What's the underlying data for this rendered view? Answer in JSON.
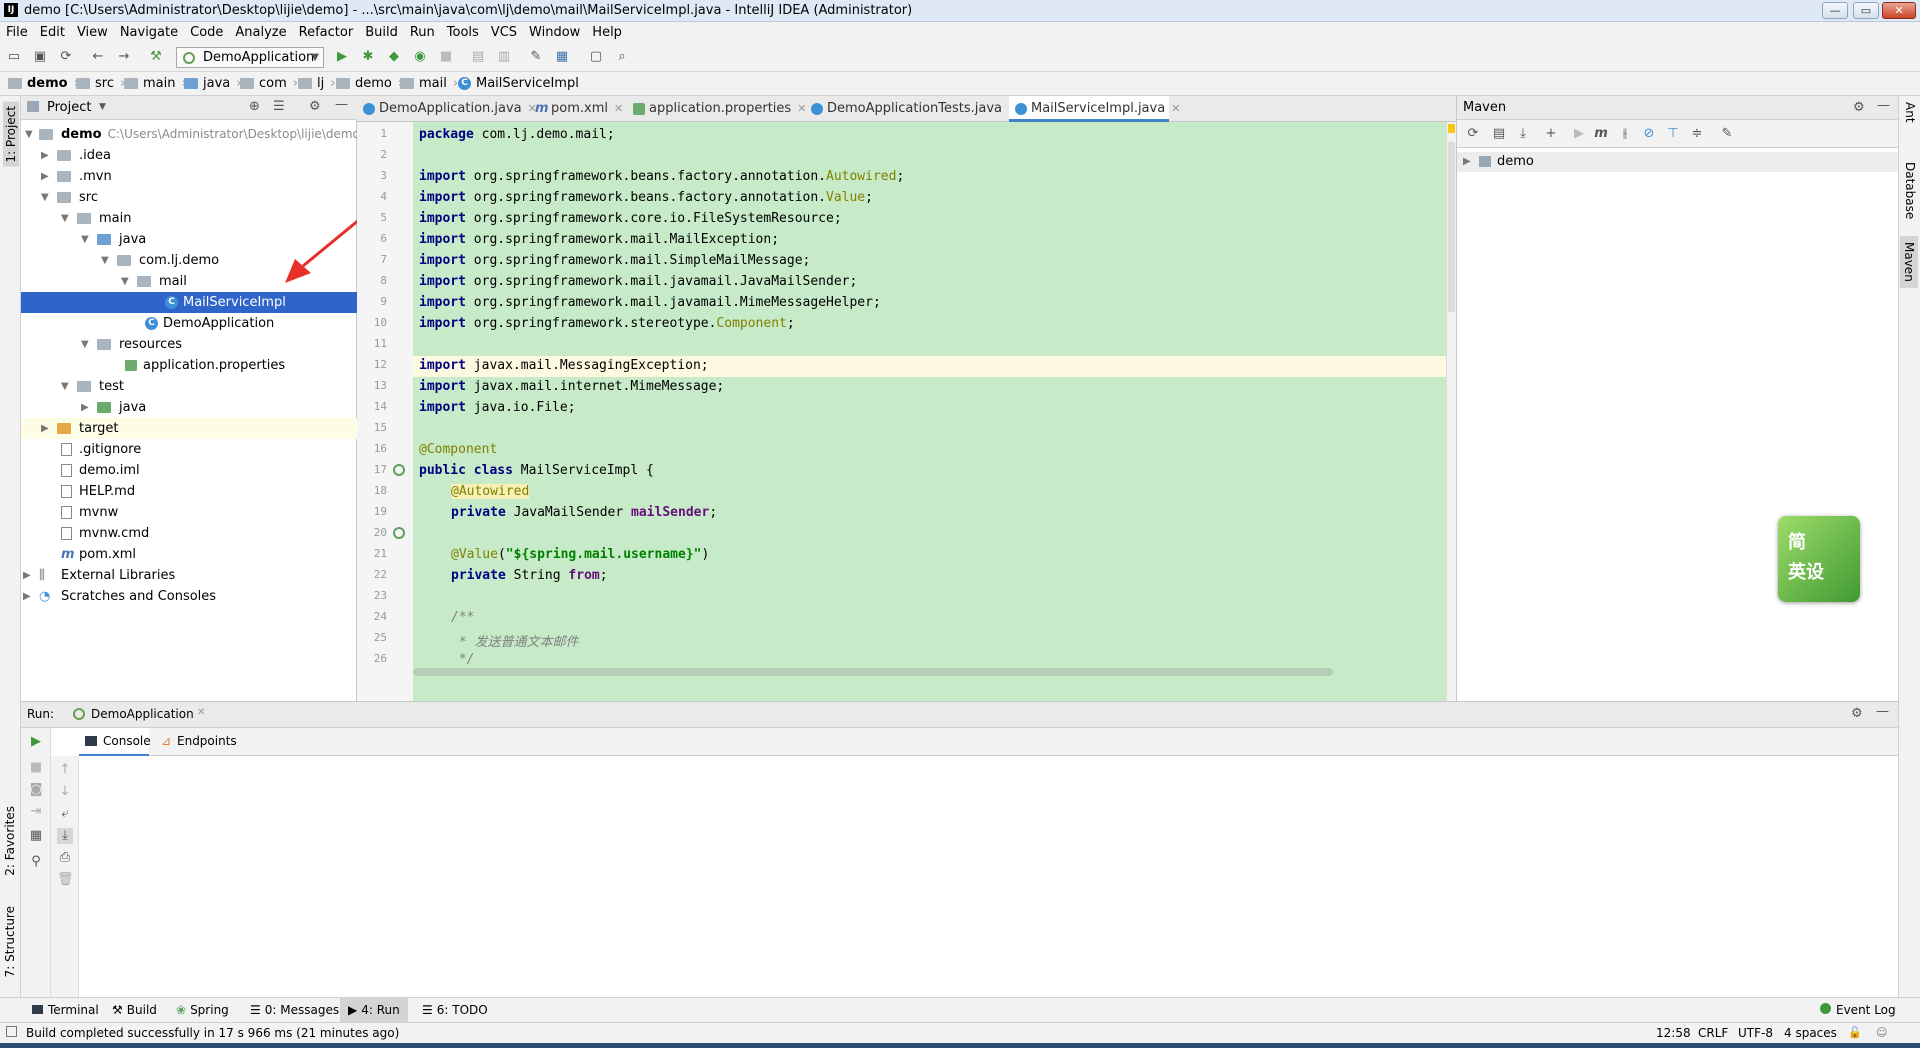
{
  "window": {
    "title": "demo [C:\\Users\\Administrator\\Desktop\\lijie\\demo] - ...\\src\\main\\java\\com\\lj\\demo\\mail\\MailServiceImpl.java - IntelliJ IDEA (Administrator)",
    "logo": "IJ",
    "minimize": "—",
    "maximize": "▭",
    "close": "✕"
  },
  "menu": [
    "File",
    "Edit",
    "View",
    "Navigate",
    "Code",
    "Analyze",
    "Refactor",
    "Build",
    "Run",
    "Tools",
    "VCS",
    "Window",
    "Help"
  ],
  "toolbar": {
    "run_config": "DemoApplication",
    "icons": [
      "folder-open-icon",
      "save-icon",
      "sync-icon",
      "back-icon",
      "forward-icon",
      "hammer-icon",
      "run-icon",
      "debug-icon",
      "coverage-icon",
      "profile-icon",
      "stop-icon",
      "vcs-update-icon",
      "vcs-commit-icon",
      "wrench-icon",
      "structure-icon",
      "frame-icon",
      "search-icon"
    ]
  },
  "breadcrumb": [
    "demo",
    "src",
    "main",
    "java",
    "com",
    "lj",
    "demo",
    "mail",
    "MailServiceImpl"
  ],
  "left_stripe": {
    "project": "1: Project",
    "favorites": "2: Favorites",
    "structure": "7: Structure"
  },
  "project_panel": {
    "title": "Project",
    "items": [
      {
        "label": "demo",
        "path": "C:\\Users\\Administrator\\Desktop\\lijie\\demo"
      },
      {
        "label": ".idea"
      },
      {
        "label": ".mvn"
      },
      {
        "label": "src"
      },
      {
        "label": "main"
      },
      {
        "label": "java"
      },
      {
        "label": "com.lj.demo"
      },
      {
        "label": "mail"
      },
      {
        "label": "MailServiceImpl"
      },
      {
        "label": "DemoApplication"
      },
      {
        "label": "resources"
      },
      {
        "label": "application.properties"
      },
      {
        "label": "test"
      },
      {
        "label": "java"
      },
      {
        "label": "target"
      },
      {
        "label": ".gitignore"
      },
      {
        "label": "demo.iml"
      },
      {
        "label": "HELP.md"
      },
      {
        "label": "mvnw"
      },
      {
        "label": "mvnw.cmd"
      },
      {
        "label": "pom.xml"
      },
      {
        "label": "External Libraries"
      },
      {
        "label": "Scratches and Consoles"
      }
    ]
  },
  "editor": {
    "tabs": [
      {
        "label": "DemoApplication.java"
      },
      {
        "label": "pom.xml"
      },
      {
        "label": "application.properties"
      },
      {
        "label": "DemoApplicationTests.java"
      },
      {
        "label": "MailServiceImpl.java"
      }
    ],
    "line_numbers": [
      "1",
      "2",
      "3",
      "4",
      "5",
      "6",
      "7",
      "8",
      "9",
      "10",
      "11",
      "12",
      "13",
      "14",
      "15",
      "16",
      "17",
      "18",
      "19",
      "20",
      "21",
      "22",
      "23",
      "24",
      "25",
      "26"
    ],
    "lines": {
      "l1": {
        "kw": "package",
        "rest": " com.lj.demo.mail;"
      },
      "l3": {
        "kw": "import",
        "rest": " org.springframework.beans.factory.annotation.",
        "an": "Autowired",
        "end": ";"
      },
      "l4": {
        "kw": "import",
        "rest": " org.springframework.beans.factory.annotation.",
        "an": "Value",
        "end": ";"
      },
      "l5": {
        "kw": "import",
        "rest": " org.springframework.core.io.FileSystemResource;"
      },
      "l6": {
        "kw": "import",
        "rest": " org.springframework.mail.MailException;"
      },
      "l7": {
        "kw": "import",
        "rest": " org.springframework.mail.SimpleMailMessage;"
      },
      "l8": {
        "kw": "import",
        "rest": " org.springframework.mail.javamail.JavaMailSender;"
      },
      "l9": {
        "kw": "import",
        "rest": " org.springframework.mail.javamail.MimeMessageHelper;"
      },
      "l10": {
        "kw": "import",
        "rest": " org.springframework.stereotype.",
        "an": "Component",
        "end": ";"
      },
      "l12": {
        "kw": "import",
        "rest": " javax.mail.MessagingException;"
      },
      "l13": {
        "kw": "import",
        "rest": " javax.mail.internet.MimeMessage;"
      },
      "l14": {
        "kw": "import",
        "rest": " java.io.File;"
      },
      "l16": {
        "an": "@Component"
      },
      "l17": {
        "kw": "public class",
        "rest": " MailServiceImpl {"
      },
      "l18": {
        "an": "@Autowired"
      },
      "l19": {
        "kw": "private",
        "rest": " JavaMailSender ",
        "fld": "mailSender",
        "end": ";"
      },
      "l21": {
        "an": "@Value",
        "open": "(",
        "str": "\"${spring.mail.username}\"",
        "end": ")"
      },
      "l22": {
        "kw": "private",
        "rest": " String ",
        "fld": "from",
        "end": ";"
      },
      "l24": {
        "cmt": "/**"
      },
      "l25": {
        "cmt": " * 发送普通文本邮件"
      },
      "l26": {
        "cmt": " */"
      }
    }
  },
  "maven_panel": {
    "title": "Maven",
    "root": "demo"
  },
  "right_stripe": {
    "ant": "Ant",
    "database": "Database",
    "maven": "Maven"
  },
  "run_panel": {
    "label": "Run:",
    "config": "DemoApplication",
    "tabs": [
      "Console",
      "Endpoints"
    ]
  },
  "tool_windows": [
    {
      "label": "Terminal"
    },
    {
      "label": "Build"
    },
    {
      "label": "Spring"
    },
    {
      "label": "0: Messages"
    },
    {
      "label": "4: Run"
    },
    {
      "label": "6: TODO"
    }
  ],
  "event_log": "Event Log",
  "status": {
    "message": "Build completed successfully in 17 s 966 ms (21 minutes ago)",
    "position": "12:58",
    "line_sep": "CRLF",
    "encoding": "UTF-8",
    "indent": "4 spaces"
  },
  "floating_widget": {
    "line1": "简",
    "line2": "英设"
  }
}
